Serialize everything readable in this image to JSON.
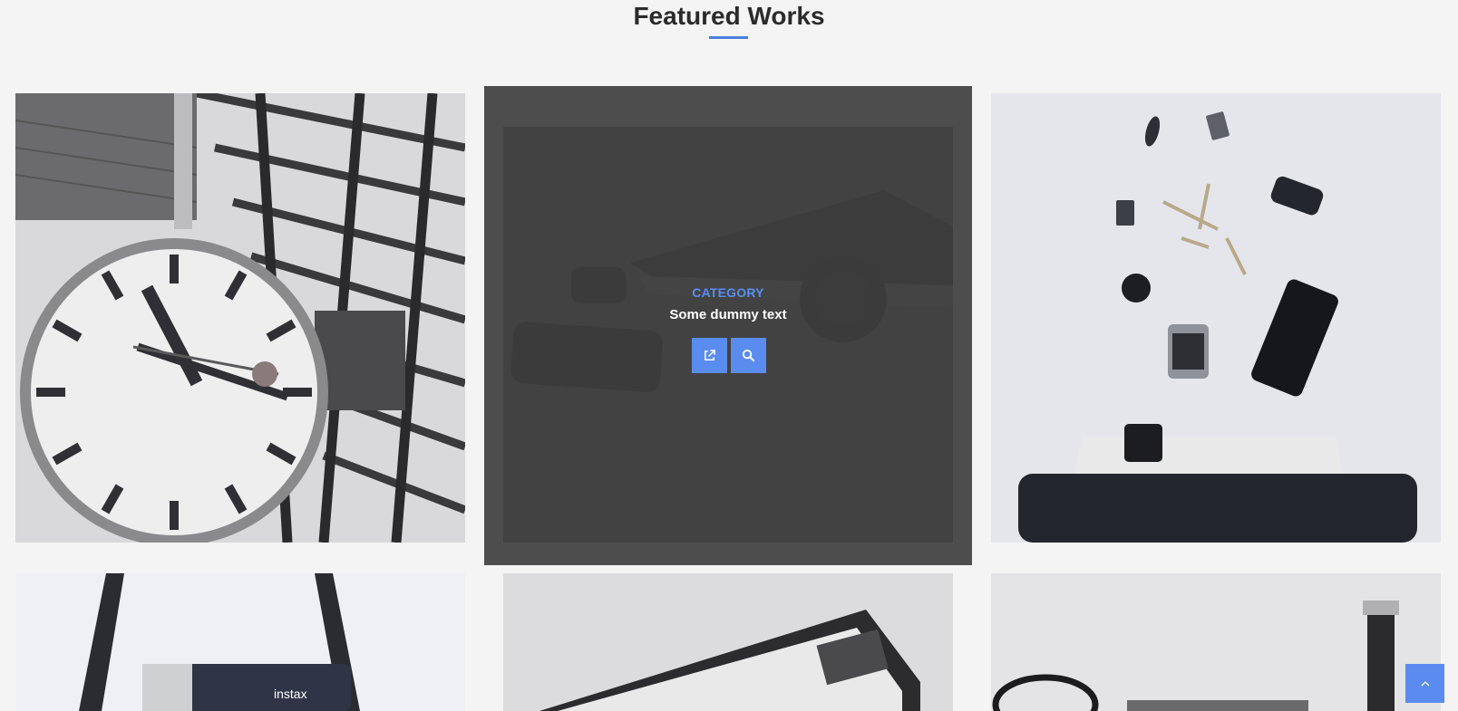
{
  "section": {
    "title": "Featured Works"
  },
  "portfolio": {
    "hover": {
      "category": "CATEGORY",
      "text": "Some dummy text",
      "link_icon": "external-link-icon",
      "zoom_icon": "search-icon"
    },
    "items": [
      {
        "subject": "station clock under glass roof"
      },
      {
        "subject": "desk with laptop, smartwatch, phone and headphones"
      },
      {
        "subject": "flat lay with keys, camera lens, phone and laptop bag"
      },
      {
        "subject": "instax mini 90 camera on strap"
      },
      {
        "subject": "vintage camera top view"
      },
      {
        "subject": "glasses and wristwatch flat lay"
      }
    ]
  },
  "back_to_top": {
    "icon": "chevron-up-icon"
  },
  "colors": {
    "accent": "#5a8cf0",
    "background": "#f4f4f4",
    "overlay": "#3e3e3e"
  }
}
